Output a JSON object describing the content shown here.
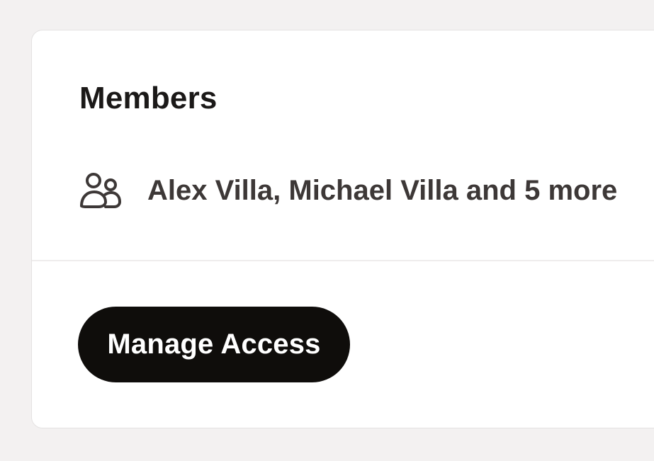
{
  "members_card": {
    "title": "Members",
    "members_icon": "people-icon",
    "members_summary": "Alex Villa, Michael Villa and 5 more",
    "manage_button_label": "Manage Access"
  }
}
